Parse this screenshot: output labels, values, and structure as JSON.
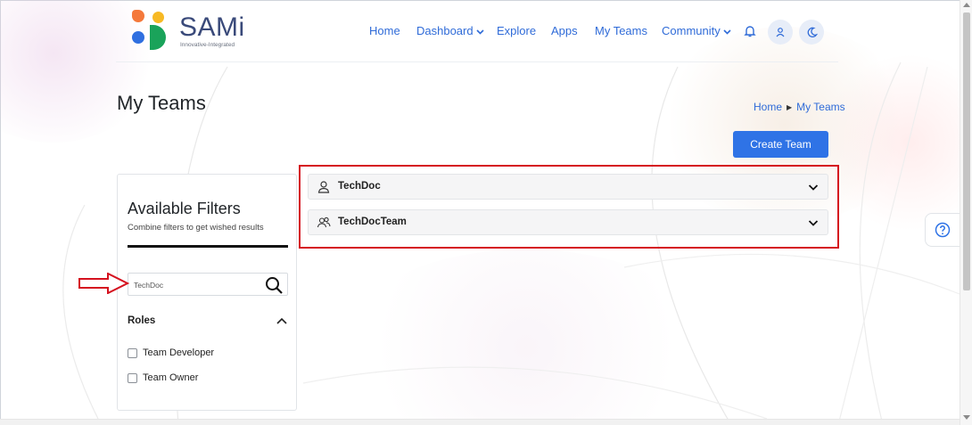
{
  "brand": {
    "name": "SAMi",
    "tagline": "Innovative-Integrated",
    "colors": {
      "orange": "#f4793b",
      "yellow": "#f7b924",
      "blue": "#2f6fe0",
      "green": "#1aa35a",
      "text": "#3a4a7a"
    }
  },
  "nav": {
    "items": [
      {
        "label": "Home"
      },
      {
        "label": "Dashboard",
        "dropdown": true
      },
      {
        "label": "Explore"
      },
      {
        "label": "Apps"
      },
      {
        "label": "My Teams"
      },
      {
        "label": "Community",
        "dropdown": true
      }
    ],
    "icons": [
      "bell-icon",
      "user-icon",
      "moon-icon"
    ]
  },
  "page": {
    "title": "My Teams",
    "breadcrumb": [
      "Home",
      "My Teams"
    ],
    "create_button": "Create Team"
  },
  "filters": {
    "title": "Available Filters",
    "subtitle": "Combine filters to get wished results",
    "search_value": "TechDoc",
    "roles_label": "Roles",
    "roles": [
      "Team Developer",
      "Team Owner"
    ]
  },
  "teams": [
    {
      "name": "TechDoc",
      "icon": "user-icon"
    },
    {
      "name": "TechDocTeam",
      "icon": "users-icon"
    }
  ],
  "colors": {
    "accent": "#2f73e6",
    "link": "#2f6bd8",
    "annotation": "#d5121f"
  }
}
